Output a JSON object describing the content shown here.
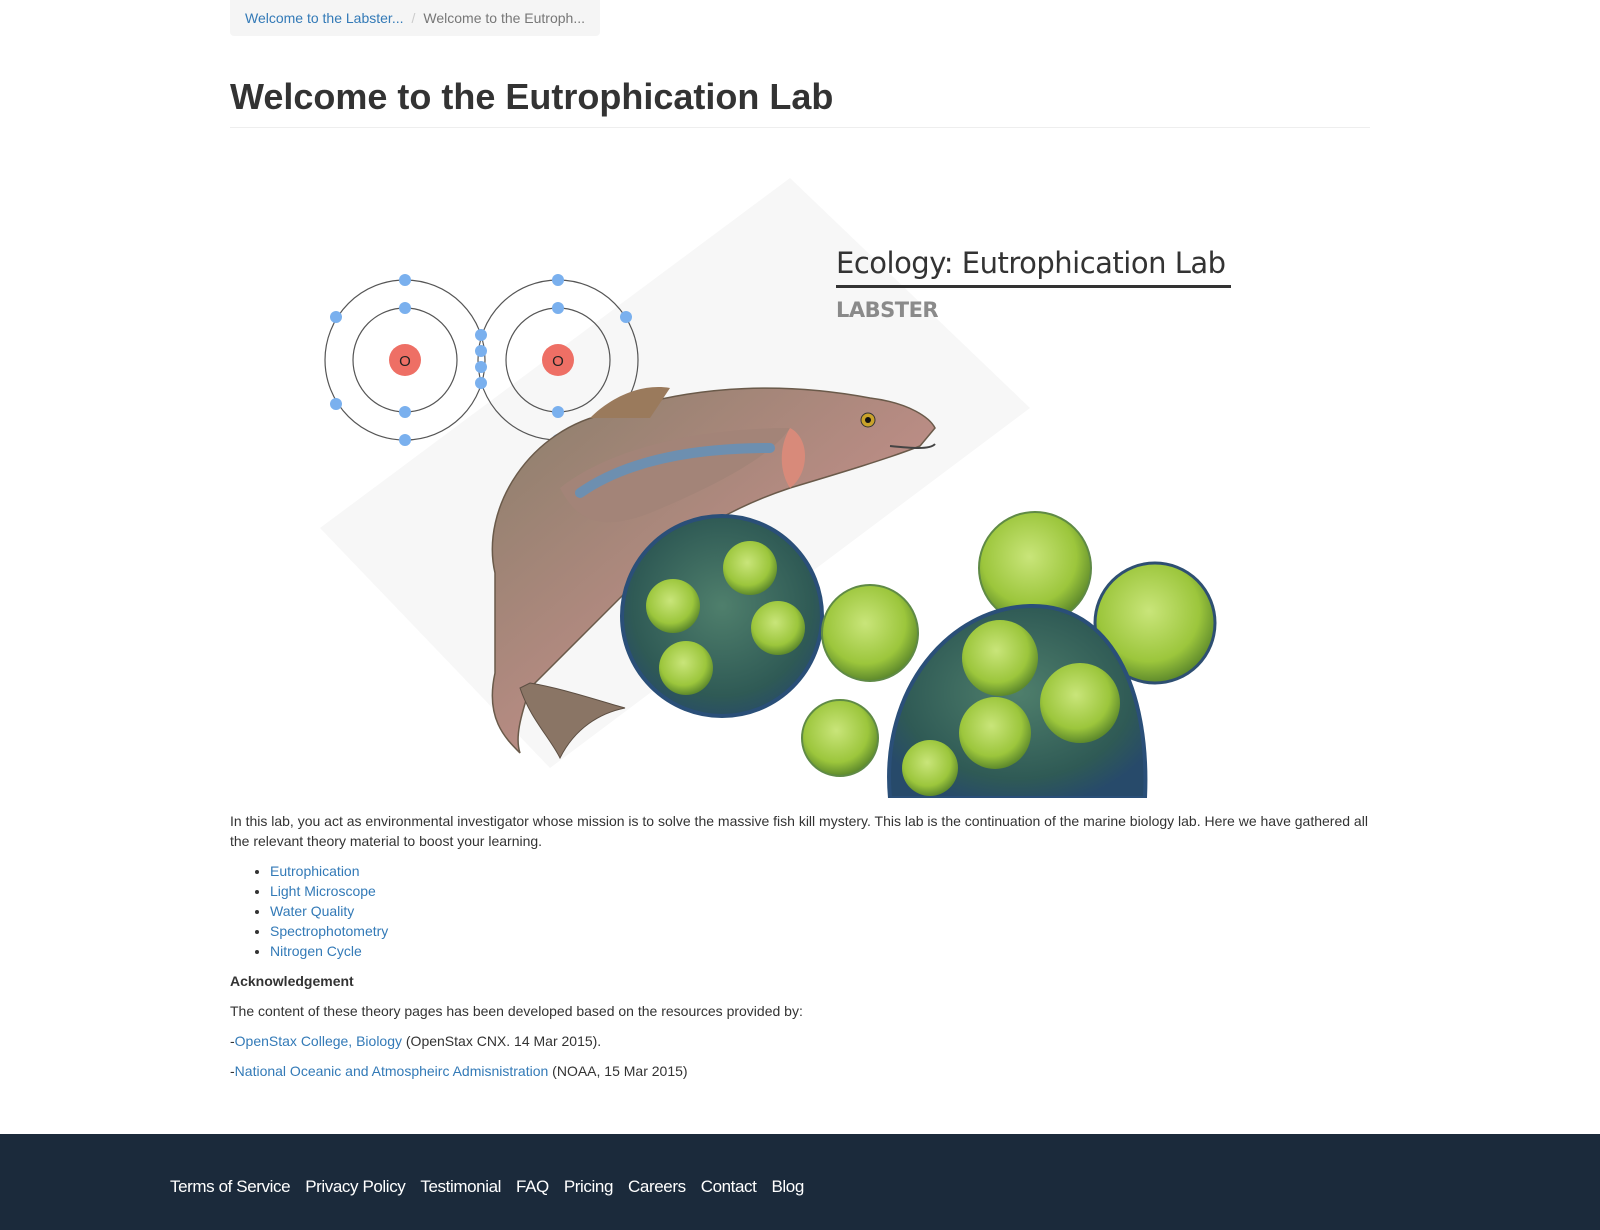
{
  "breadcrumb": {
    "items": [
      "Welcome to the Labster...",
      "Welcome to the Eutroph..."
    ],
    "separator": "/"
  },
  "page": {
    "title": "Welcome to the Eutrophication Lab"
  },
  "hero": {
    "title": "Ecology: Eutrophication Lab",
    "subtitle": "LABSTER",
    "atom_labels": [
      "O",
      "O"
    ]
  },
  "content": {
    "intro": "In this lab, you act as environmental investigator whose mission is to solve the massive fish kill mystery. This lab is the continuation of the marine biology lab. Here we have gathered all the relevant theory material to boost your learning.",
    "topics": [
      "Eutrophication",
      "Light Microscope",
      "Water Quality",
      "Spectrophotometry",
      "Nitrogen Cycle"
    ],
    "ack_heading": "Acknowledgement",
    "ack_intro": "The content of these theory pages has been developed based on the resources provided by:",
    "sources": [
      {
        "prefix": "-",
        "link": "OpenStax College, Biology",
        "suffix": " (OpenStax CNX. 14 Mar 2015)."
      },
      {
        "prefix": "-",
        "link": "National Oceanic and Atmospheirc Admisnistration",
        "suffix": " (NOAA, 15 Mar 2015)"
      }
    ]
  },
  "footer": {
    "links": [
      "Terms of Service",
      "Privacy Policy",
      "Testimonial",
      "FAQ",
      "Pricing",
      "Careers",
      "Contact",
      "Blog"
    ]
  },
  "colors": {
    "link": "#337ab7",
    "footer_bg": "#1b2a3b",
    "electron": "#7ab0ee",
    "nucleus": "#ee6f65",
    "algae": "#9cc63c"
  }
}
